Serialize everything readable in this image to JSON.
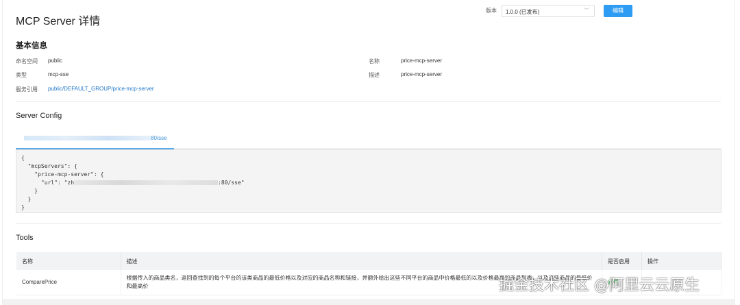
{
  "header": {
    "title": "MCP Server 详情",
    "version_label": "版本",
    "version_value": "1.0.0 (已发布)",
    "edit_button": "编辑"
  },
  "basic": {
    "title": "基本信息",
    "namespace_label": "命名空间",
    "namespace": "public",
    "type_label": "类型",
    "type": "mcp-sse",
    "service_ref_label": "服务引用",
    "service_ref": "public/DEFAULT_GROUP/price-mcp-server",
    "name_label": "名称",
    "name": "price-mcp-server",
    "desc_label": "描述",
    "desc": "price-mcp-server"
  },
  "server_config": {
    "title": "Server Config",
    "tab_suffix": "80/sse",
    "code": {
      "l1": "{",
      "l2": "  \"mcpServers\": {",
      "l3": "    \"price-mcp-server\": {",
      "l4a": "      \"url\": \"zh",
      "l4b": ":80/sse\"",
      "l5": "    }",
      "l6": "  }",
      "l7": "}"
    }
  },
  "tools": {
    "title": "Tools",
    "columns": [
      "名称",
      "描述",
      "是否启用",
      "操作"
    ],
    "rows": [
      {
        "name": "ComparePrice",
        "description": "根据传入的商品类名，返回查找到的每个平台的该类商品的最低价格以及对应的商品名称和链接，并额外给出这些不同平台的商品中价格最低的以及价格最高的商品列表，以及这些商品的最低价和最高价",
        "enabled": "启用"
      }
    ]
  },
  "watermark": "掘金技术社区 @阿里云云原生"
}
